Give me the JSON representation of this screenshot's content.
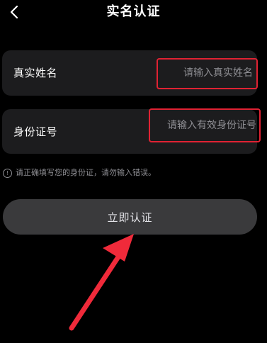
{
  "header": {
    "title": "实名认证",
    "back_icon": "chevron-left-icon"
  },
  "form": {
    "name_field": {
      "label": "真实姓名",
      "placeholder": "请输入真实姓名",
      "value": ""
    },
    "id_field": {
      "label": "身份证号",
      "placeholder": "请输入有效身份证号",
      "value": ""
    },
    "notice": {
      "icon": "info-icon",
      "icon_glyph": "!",
      "text": "请正确填写您的身份证，请勿输入错误。"
    },
    "submit_label": "立即认证"
  },
  "annotations": {
    "highlight_color": "#e02233",
    "arrow_color": "#f02a3a"
  },
  "colors": {
    "background": "#000000",
    "card": "#1c1c1e",
    "button": "#3a3a3c",
    "placeholder": "#8e8e93"
  }
}
